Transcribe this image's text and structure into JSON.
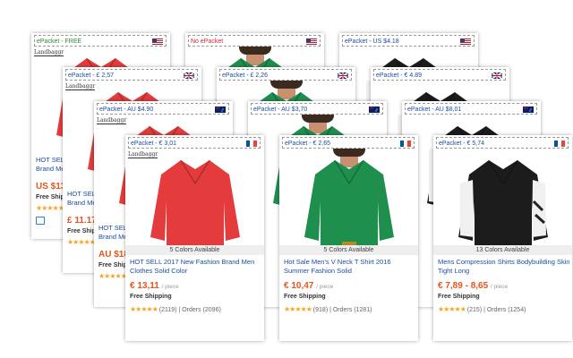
{
  "columns": [
    {
      "title": "HOT SELL 2017 New Fashion Brand Men Clothes Solid Color",
      "colors_label": "5 Colors Available",
      "price": "€ 13,11",
      "piece": "/ piece",
      "free_shipping": "Free Shipping",
      "stars": "★★★★★",
      "reviews": "(2119)",
      "orders": "Orders (2096)",
      "brand": "Landbaggr",
      "product_color": "#e43c3c",
      "cards": [
        {
          "label": "ePacket - FREE",
          "flag": "us",
          "style": "green",
          "partial_title": "HOT SELL",
          "partial_title2": "Brand Me",
          "partial_price": "US $13.7",
          "partial_free": "Free Shipp"
        },
        {
          "label": "ePacket - £ 2,57",
          "flag": "uk",
          "style": "",
          "partial_title": "HOT SELL",
          "partial_title2": "Brand Me",
          "partial_price": "£ 11.17",
          "partial_free": "Free Shipp"
        },
        {
          "label": "ePacket - AU $4.90",
          "flag": "au",
          "style": "",
          "partial_title": "HOT SELL",
          "partial_title2": "Brand Me",
          "partial_price": "AU $18.3",
          "partial_free": "Free Shipp"
        },
        {
          "label": "ePacket - € 3,01",
          "flag": "fr",
          "style": ""
        }
      ]
    },
    {
      "title": "Hot Sale Men's V Neck T Shirt 2016 Summer Fashion Solid",
      "colors_label": "5 Colors Available",
      "price": "€ 10,47",
      "piece": "/ piece",
      "free_shipping": "Free Shipping",
      "stars": "★★★★★",
      "reviews": "(918)",
      "orders": "Orders (1281)",
      "product_color": "#1f8f4e",
      "cards": [
        {
          "label": "No ePacket",
          "flag": "us",
          "style": "red"
        },
        {
          "label": "ePacket - £ 2,26",
          "flag": "uk",
          "style": ""
        },
        {
          "label": "ePacket - AU $3,70",
          "flag": "au",
          "style": ""
        },
        {
          "label": "ePacket - € 2,65",
          "flag": "fr",
          "style": ""
        }
      ]
    },
    {
      "title": "Mens Compression Shirts Bodybuilding Skin Tight Long",
      "colors_label": "13 Colors Available",
      "price": "€ 7,89 - 8,65",
      "piece": "/ piece",
      "free_shipping": "Free Shipping",
      "stars": "★★★★★",
      "reviews": "(215)",
      "orders": "Orders (1254)",
      "product_color": "#1c1c1c",
      "cards": [
        {
          "label": "ePacket - US $4.18",
          "flag": "us",
          "style": ""
        },
        {
          "label": "ePacket - € 4.89",
          "flag": "uk",
          "style": ""
        },
        {
          "label": "ePacket - AU $8,01",
          "flag": "au",
          "style": ""
        },
        {
          "label": "ePacket - € 5,74",
          "flag": "fr",
          "style": ""
        }
      ]
    }
  ],
  "colors": {
    "link_blue": "#1a4da3",
    "price_orange": "#e9541a",
    "star_gold": "#f5a623"
  }
}
